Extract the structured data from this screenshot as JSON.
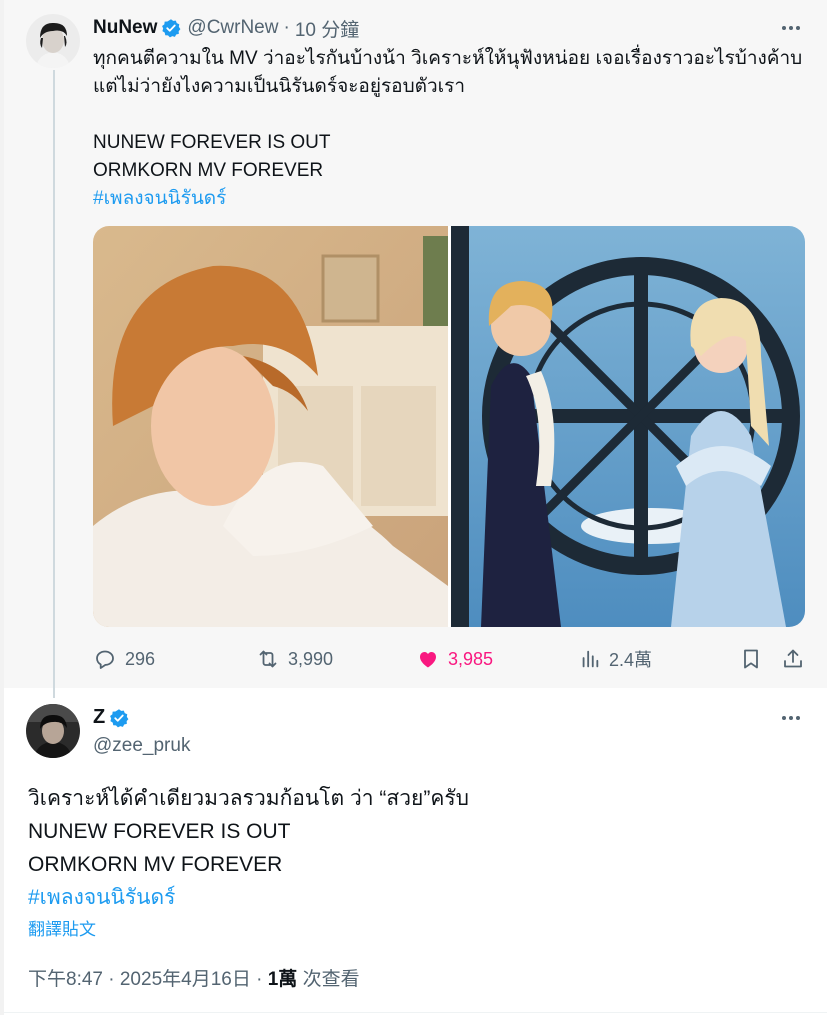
{
  "parent_post": {
    "display_name": "NuNew",
    "handle": "@CwrNew",
    "separator": "·",
    "time_ago": "10 分鐘",
    "text_lines": [
      "ทุกคนตีความใน MV ว่าอะไรกันบ้างน้า วิเคราะห์ให้นุฟังหน่อย เจอเรื่องราวอะไรบ้างค้าบ",
      "แต่ไม่ว่ายังไงความเป็นนิรันดร์จะอยู่รอบตัวเรา",
      "",
      "NUNEW FOREVER IS OUT",
      "ORMKORN MV FOREVER"
    ],
    "hashtag": "#เพลงจนนิรันดร์",
    "media": [
      {
        "icon": "photo-portrait-warm"
      },
      {
        "icon": "photo-clock-couple"
      }
    ],
    "stats": {
      "replies": "296",
      "reposts": "3,990",
      "likes": "3,985",
      "views": "2.4萬"
    }
  },
  "reply_post": {
    "display_name": "Z",
    "handle": "@zee_pruk",
    "text_lines": [
      "วิเคราะห์ได้คำเดียวมวลรวมก้อนโต ว่า “สวย”ครับ",
      "NUNEW FOREVER IS OUT",
      "ORMKORN MV FOREVER"
    ],
    "hashtag": "#เพลงจนนิรันดร์",
    "translate_label": "翻譯貼文",
    "timestamp": "下午8:47 · 2025年4月16日 · ",
    "view_count": "1萬",
    "view_label": " 次查看"
  },
  "icons": {
    "verified": "verified-badge-icon",
    "more": "more-options-icon",
    "reply": "reply-icon",
    "repost": "repost-icon",
    "like": "heart-icon",
    "views": "views-chart-icon",
    "bookmark": "bookmark-icon",
    "share": "share-icon"
  },
  "colors": {
    "accent": "#1d9bf0",
    "like": "#f91880",
    "muted": "#536471",
    "parent_background": "#f7f7f7"
  }
}
